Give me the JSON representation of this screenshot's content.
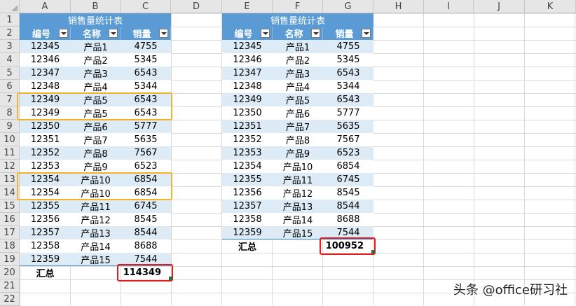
{
  "columns": [
    "A",
    "B",
    "C",
    "D",
    "E",
    "F",
    "G",
    "H",
    "I",
    "J",
    "K"
  ],
  "rows": [
    "1",
    "2",
    "3",
    "4",
    "5",
    "6",
    "7",
    "8",
    "9",
    "10",
    "11",
    "12",
    "13",
    "14",
    "15",
    "16",
    "17",
    "18",
    "19",
    "20",
    "21",
    "22"
  ],
  "table1": {
    "title": "销售量统计表",
    "headers": [
      "编号",
      "名称",
      "销量"
    ],
    "rows": [
      [
        "12345",
        "产品1",
        "4755"
      ],
      [
        "12346",
        "产品2",
        "5345"
      ],
      [
        "12347",
        "产品3",
        "6543"
      ],
      [
        "12348",
        "产品4",
        "5344"
      ],
      [
        "12349",
        "产品5",
        "6543"
      ],
      [
        "12349",
        "产品5",
        "6543"
      ],
      [
        "12350",
        "产品6",
        "5777"
      ],
      [
        "12351",
        "产品7",
        "5635"
      ],
      [
        "12352",
        "产品8",
        "7567"
      ],
      [
        "12353",
        "产品9",
        "6523"
      ],
      [
        "12354",
        "产品10",
        "6854"
      ],
      [
        "12354",
        "产品10",
        "6854"
      ],
      [
        "12355",
        "产品11",
        "6745"
      ],
      [
        "12356",
        "产品12",
        "8545"
      ],
      [
        "12357",
        "产品13",
        "8544"
      ],
      [
        "12358",
        "产品14",
        "8688"
      ],
      [
        "12359",
        "产品15",
        "7544"
      ]
    ],
    "total_label": "汇总",
    "total_value": "114349"
  },
  "table2": {
    "title": "销售量统计表",
    "headers": [
      "编号",
      "名称",
      "销量"
    ],
    "rows": [
      [
        "12345",
        "产品1",
        "4755"
      ],
      [
        "12346",
        "产品2",
        "5345"
      ],
      [
        "12347",
        "产品3",
        "6543"
      ],
      [
        "12348",
        "产品4",
        "5344"
      ],
      [
        "12349",
        "产品5",
        "6543"
      ],
      [
        "12350",
        "产品6",
        "5777"
      ],
      [
        "12351",
        "产品7",
        "5635"
      ],
      [
        "12352",
        "产品8",
        "7567"
      ],
      [
        "12353",
        "产品9",
        "6523"
      ],
      [
        "12354",
        "产品10",
        "6854"
      ],
      [
        "12355",
        "产品11",
        "6745"
      ],
      [
        "12356",
        "产品12",
        "8545"
      ],
      [
        "12357",
        "产品13",
        "8544"
      ],
      [
        "12358",
        "产品14",
        "8688"
      ],
      [
        "12359",
        "产品15",
        "7544"
      ]
    ],
    "total_label": "汇总",
    "total_value": "100952"
  },
  "watermark": "头条 @office研习社",
  "colors": {
    "header_blue": "#5b9bd5",
    "band_blue": "#ddebf7",
    "dup_highlight": "#f4b228",
    "total_highlight": "#e21b1b"
  }
}
